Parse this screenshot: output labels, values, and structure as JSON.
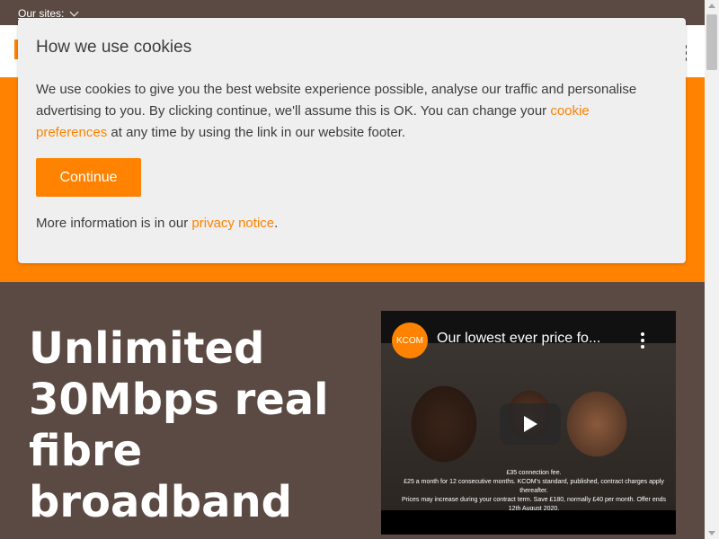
{
  "topbar": {
    "our_sites": "Our sites:"
  },
  "cookie": {
    "title": "How we use cookies",
    "text_before": "We use cookies to give you the best website experience possible, analyse our traffic and personalise advertising to you. By clicking continue, we'll assume this is OK. You can change your ",
    "link_cookie_prefs": "cookie preferences",
    "text_after": " at any time by using the link in our website footer.",
    "continue_label": "Continue",
    "more_before": "More information is in our ",
    "privacy_link": "privacy notice",
    "more_after": "."
  },
  "hero": {
    "title": "Unlimited 30Mbps real fibre broadband"
  },
  "video": {
    "logo_text": "KCOM",
    "title": "Our lowest ever price fo...",
    "fine_1": "£35 connection fee.",
    "fine_2": "£25 a month for 12 consecutive months. KCOM's standard, published, contract charges apply thereafter.",
    "fine_3": "Prices may increase during your contract term. Save £180, normally £40 per month. Offer ends 12th August 2020."
  },
  "colors": {
    "brand_orange": "#ff8200",
    "brown": "#5b4a43"
  }
}
